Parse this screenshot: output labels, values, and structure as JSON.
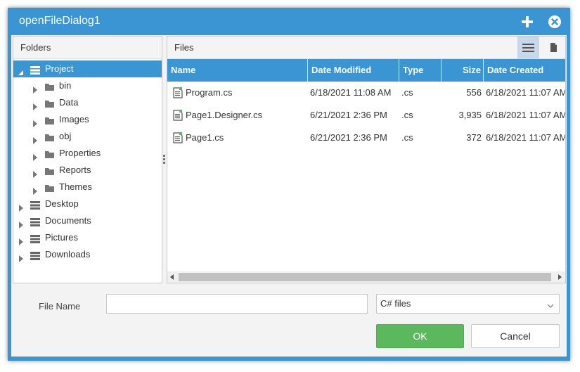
{
  "window": {
    "title": "openFileDialog1"
  },
  "titlebar_icons": [
    "plus-icon",
    "close-circle-icon"
  ],
  "folders": {
    "header": "Folders",
    "tree": [
      {
        "label": "Project",
        "expanded": true,
        "selected": true,
        "icon": "drive-icon"
      },
      {
        "label": "bin",
        "icon": "folder-icon"
      },
      {
        "label": "Data",
        "icon": "folder-icon"
      },
      {
        "label": "Images",
        "icon": "folder-icon"
      },
      {
        "label": "obj",
        "icon": "folder-icon"
      },
      {
        "label": "Properties",
        "icon": "folder-icon"
      },
      {
        "label": "Reports",
        "icon": "folder-icon"
      },
      {
        "label": "Themes",
        "icon": "folder-icon"
      },
      {
        "label": "Desktop",
        "icon": "drive-icon"
      },
      {
        "label": "Documents",
        "icon": "drive-icon"
      },
      {
        "label": "Pictures",
        "icon": "drive-icon"
      },
      {
        "label": "Downloads",
        "icon": "drive-icon"
      }
    ]
  },
  "files": {
    "header": "Files",
    "columns": [
      "Name",
      "Date Modified",
      "Type",
      "Size",
      "Date Created"
    ],
    "rows": [
      {
        "name": "Program.cs",
        "modified": "6/18/2021 11:08 AM",
        "type": ".cs",
        "size": "556",
        "created": "6/18/2021 11:07 AM"
      },
      {
        "name": "Page1.Designer.cs",
        "modified": "6/21/2021 2:36 PM",
        "type": ".cs",
        "size": "3,935",
        "created": "6/18/2021 11:07 AM"
      },
      {
        "name": "Page1.cs",
        "modified": "6/21/2021 2:36 PM",
        "type": ".cs",
        "size": "372",
        "created": "6/18/2021 11:07 AM"
      }
    ]
  },
  "bottom": {
    "file_name_label": "File Name",
    "file_name_value": "",
    "filter_value": "C# files",
    "ok_label": "OK",
    "cancel_label": "Cancel"
  },
  "colors": {
    "accent": "#3a95d2",
    "ok": "#5cb85c"
  }
}
